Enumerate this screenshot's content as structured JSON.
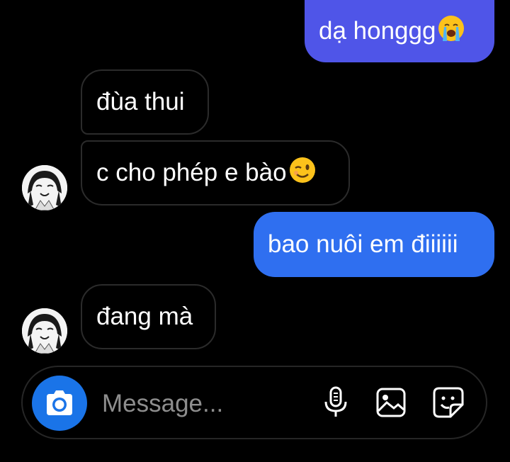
{
  "messages": [
    {
      "sender": "me",
      "text": "dạ honggg",
      "emoji": "crying-face"
    },
    {
      "sender": "them",
      "text": "đùa thui"
    },
    {
      "sender": "them",
      "text": "c cho phép e bào",
      "emoji": "winking-face"
    },
    {
      "sender": "me",
      "text": "bao nuôi em điiiiii"
    },
    {
      "sender": "them",
      "text": "đang mà"
    }
  ],
  "composer": {
    "placeholder": "Message...",
    "value": ""
  },
  "icons": {
    "camera": "camera-icon",
    "microphone": "microphone-icon",
    "gallery": "image-gallery-icon",
    "sticker": "sticker-icon"
  },
  "colors": {
    "background": "#000000",
    "outgoing_top": "#4f54e6",
    "outgoing_bottom": "#2f6ff0",
    "incoming_border": "#2b2b2b",
    "camera_button": "#1a74e8",
    "placeholder": "#8e8e8e"
  }
}
